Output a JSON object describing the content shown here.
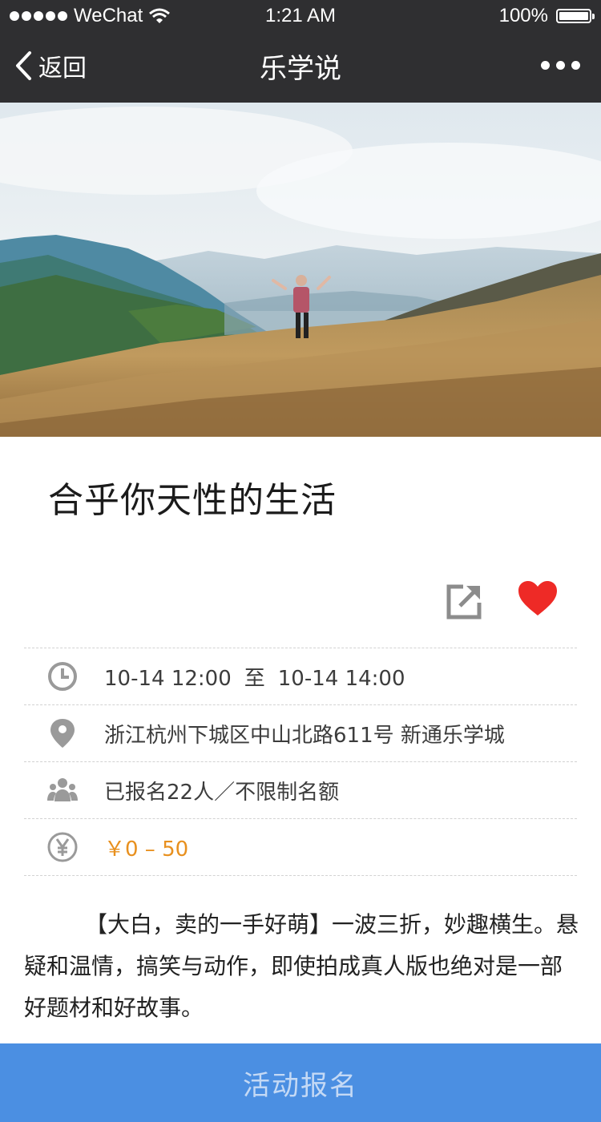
{
  "status_bar": {
    "carrier": "WeChat",
    "time": "1:21 AM",
    "battery": "100%",
    "battery_level": 1.0
  },
  "nav": {
    "back_label": "返回",
    "title": "乐学说",
    "more_icon": "more-dots-icon"
  },
  "event": {
    "title": "合乎你天性的生活",
    "time_start": "10-14 12:00",
    "time_sep": "至",
    "time_end": "10-14 14:00",
    "location": "浙江杭州下城区中山北路611号 新通乐学城",
    "enrollment": "已报名22人／不限制名额",
    "price": "￥0 – 50",
    "description": "【大白，卖的一手好萌】一波三折，妙趣横生。悬疑和温情，搞笑与动作，即使拍成真人版也绝对是一部好题材和好故事。"
  },
  "actions": {
    "share_icon": "share-icon",
    "like_icon": "heart-icon",
    "signup_label": "活动报名"
  },
  "colors": {
    "bar_bg": "#2f2f31",
    "accent_button": "#4b8fe2",
    "heart": "#ee2a26",
    "price": "#e8901e",
    "icon_gray": "#9a9a9a"
  }
}
